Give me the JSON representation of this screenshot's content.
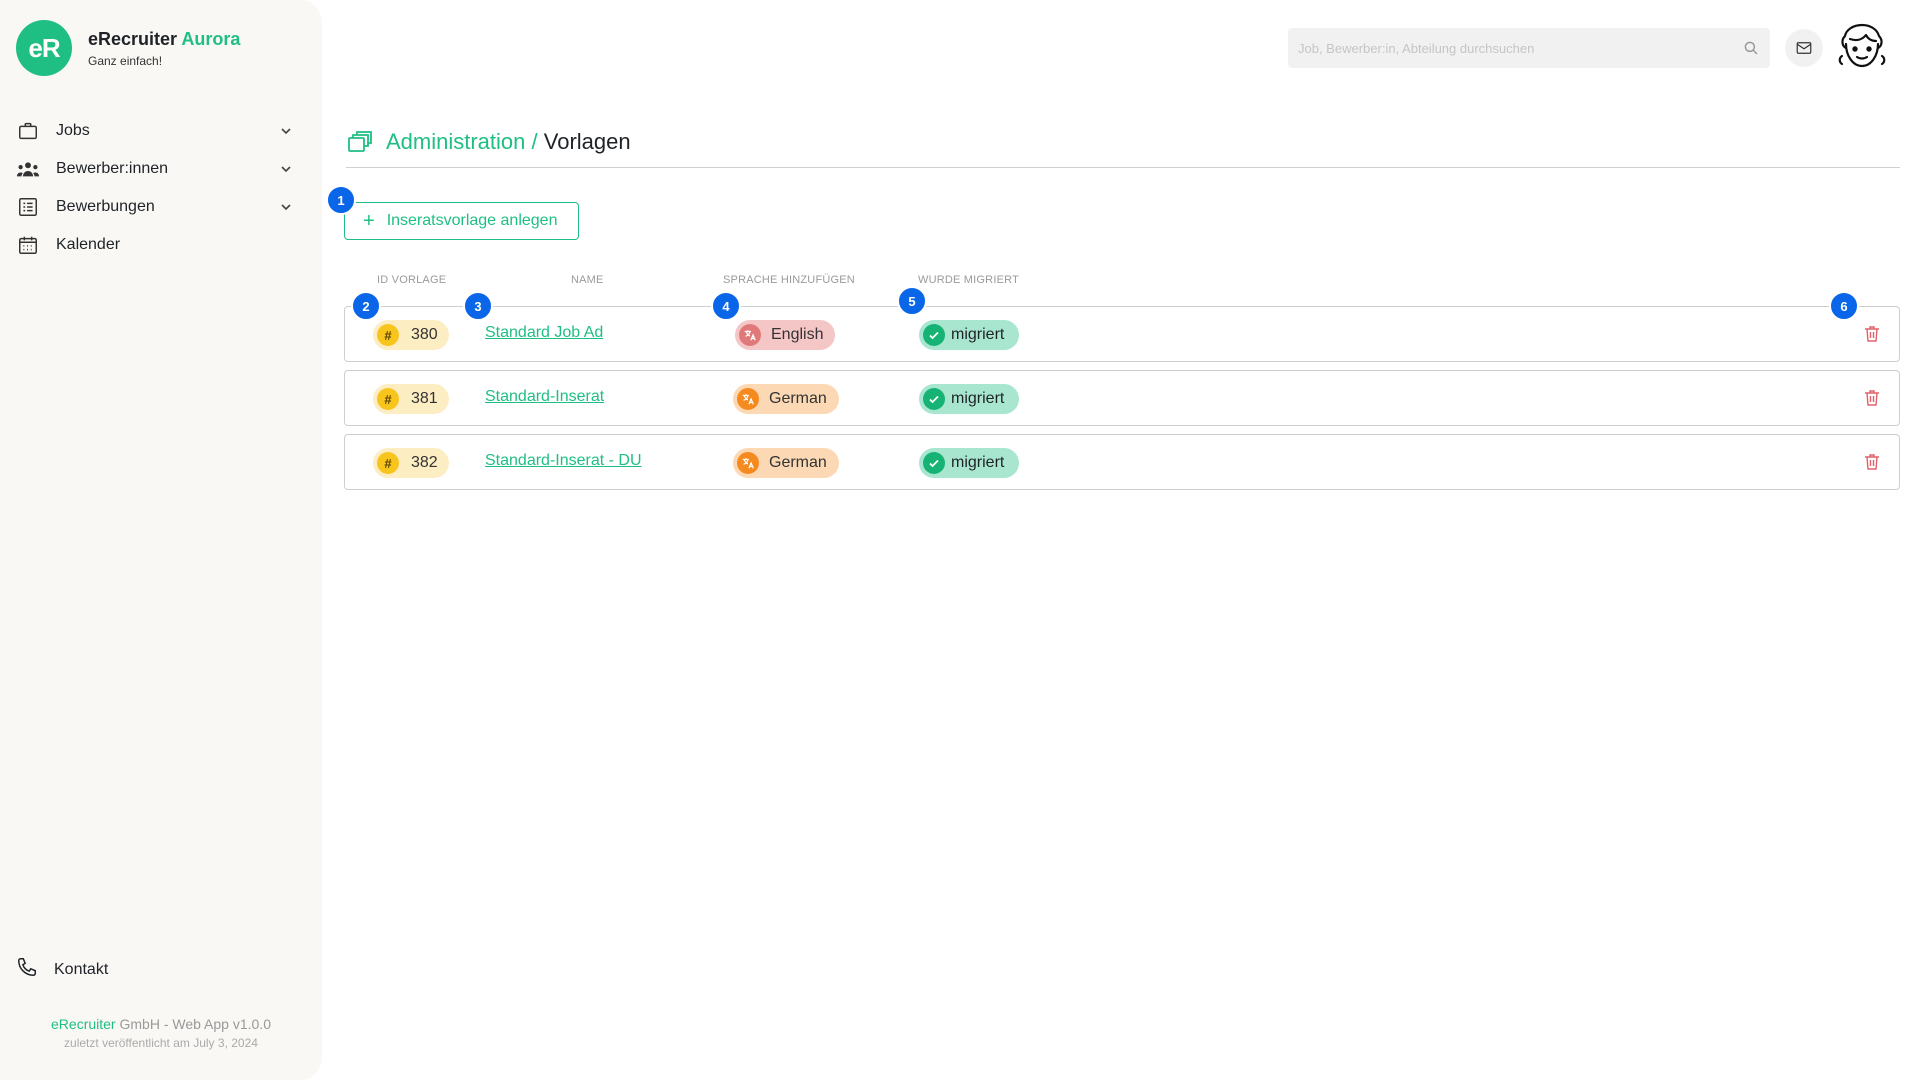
{
  "brand": {
    "logo": "eR",
    "name": "eRecruiter",
    "name_accent": "Aurora",
    "tagline": "Ganz einfach!"
  },
  "sidebar": {
    "items": [
      {
        "label": "Jobs",
        "icon": "briefcase-icon"
      },
      {
        "label": "Bewerber:innen",
        "icon": "people-icon"
      },
      {
        "label": "Bewerbungen",
        "icon": "list-icon"
      },
      {
        "label": "Kalender",
        "icon": "calendar-icon"
      }
    ],
    "contact": {
      "label": "Kontakt",
      "icon": "phone-icon"
    },
    "footer": {
      "company_accent": "eRecruiter",
      "company_rest": " GmbH - Web App v1.0.0",
      "published": "zuletzt veröffentlicht am July 3, 2024"
    }
  },
  "topbar": {
    "search_placeholder": "Job, Bewerber:in, Abteilung durchsuchen"
  },
  "breadcrumb": {
    "parent": "Administration /",
    "current": "Vorlagen"
  },
  "actions": {
    "add_label": "Inseratsvorlage anlegen"
  },
  "table": {
    "headers": [
      "ID VORLAGE",
      "NAME",
      "SPRACHE HINZUFÜGEN",
      "WURDE MIGRIERT"
    ],
    "rows": [
      {
        "id": "380",
        "name": "Standard Job Ad",
        "language": "English",
        "migrated": "migriert"
      },
      {
        "id": "381",
        "name": "Standard-Inserat",
        "language": "German",
        "migrated": "migriert"
      },
      {
        "id": "382",
        "name": "Standard-Inserat - DU",
        "language": "German",
        "migrated": "migriert"
      }
    ]
  },
  "markers": [
    "1",
    "2",
    "3",
    "4",
    "5",
    "6"
  ],
  "colors": {
    "accent": "#1fbf83",
    "id_pill": "#fdedc2",
    "lang_english_bg": "#f5c6c6",
    "lang_english_icon": "#e07a7a",
    "lang_german_bg": "#fcd9b4",
    "lang_german_icon": "#f58a1f",
    "migrated_bg": "#a8e6cf",
    "marker": "#0a66e8",
    "delete": "#e0606a"
  }
}
